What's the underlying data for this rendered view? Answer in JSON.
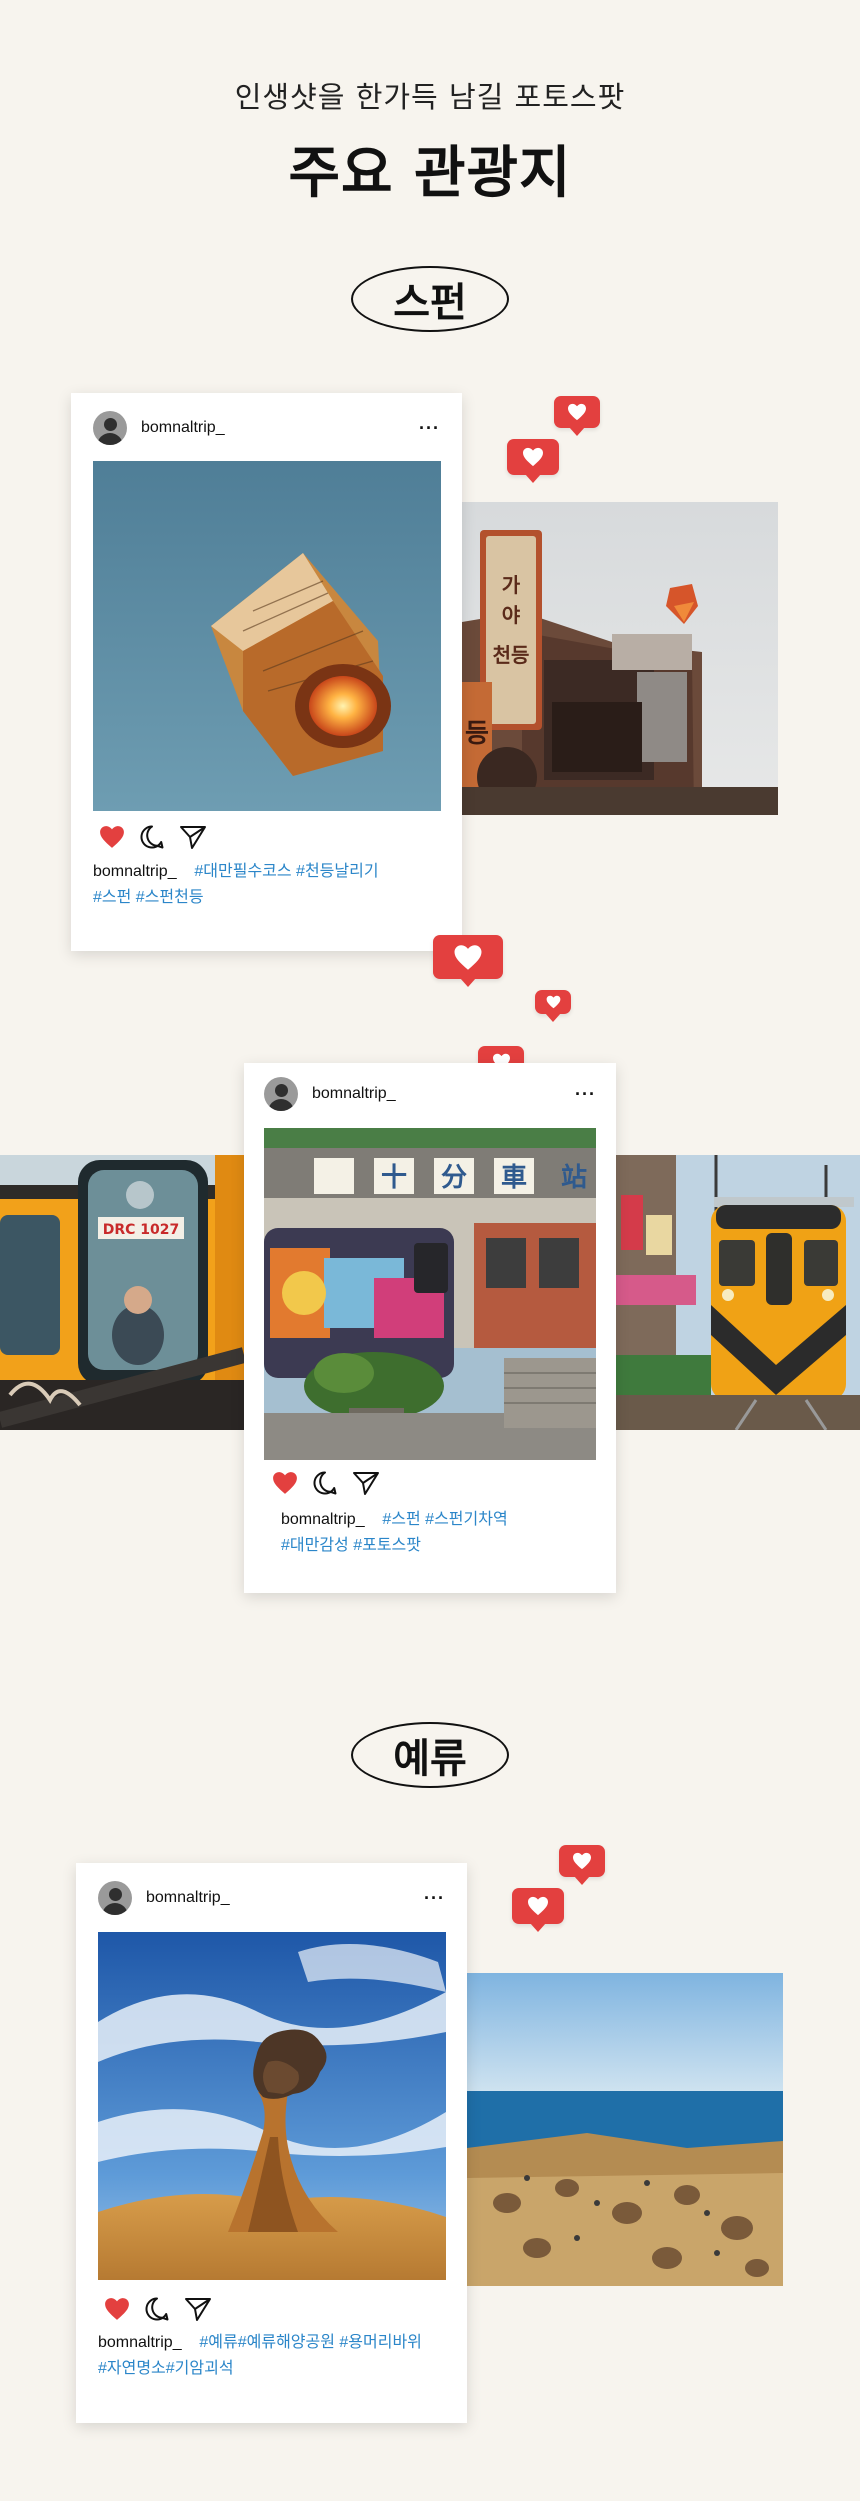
{
  "header": {
    "subtitle": "인생샷을 한가득 남길 포토스팟",
    "title": "주요 관광지"
  },
  "sections": [
    {
      "label": "스펀"
    },
    {
      "label": "예류"
    }
  ],
  "posts": [
    {
      "username": "bomnaltrip_",
      "caption_user": "bomnaltrip_",
      "tags_line1": "#대만필수코스 #천등날리기",
      "tags_line2": "#스펀 #스펀천등",
      "photo": "sky-lantern"
    },
    {
      "username": "bomnaltrip_",
      "caption_user": "bomnaltrip_",
      "tags_line1": "#스펀 #스펀기차역",
      "tags_line2": "#대만감성 #포토스팟",
      "photo": "shifen-station"
    },
    {
      "username": "bomnaltrip_",
      "caption_user": "bomnaltrip_",
      "tags_line1": "#예류#예류해양공원 #용머리바위",
      "tags_line2": "#자연명소#기암괴석",
      "photo": "queens-head-rock"
    }
  ],
  "photo_signs": {
    "train_number": "DRC 1027",
    "station_sign": [
      "十",
      "分",
      "車",
      "站"
    ],
    "vertical_sign": "천등"
  },
  "icons": {
    "more": "···",
    "like": "heart-icon",
    "comment": "comment-icon",
    "share": "send-icon"
  },
  "colors": {
    "background": "#f7f4ee",
    "heart": "#e3403f",
    "hashtag": "#2b86c9"
  }
}
